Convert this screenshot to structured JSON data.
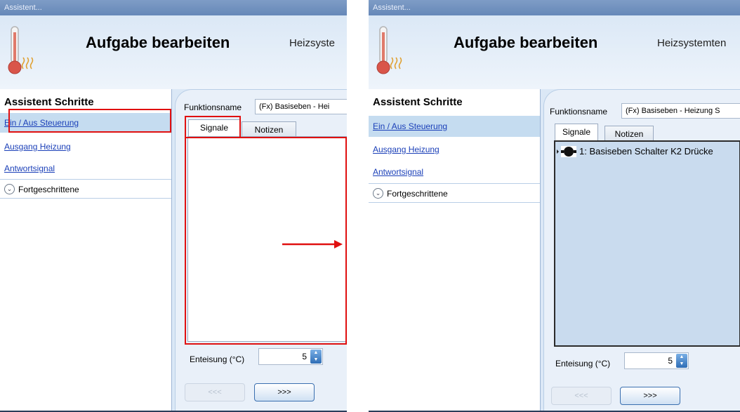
{
  "left": {
    "window_title": "Assistent...",
    "header": {
      "title": "Aufgabe bearbeiten",
      "subtitle": "Heizsyste"
    },
    "steps_title": "Assistent Schritte",
    "steps": [
      "Ein / Aus Steuerung",
      "Ausgang Heizung",
      "Antwortsignal"
    ],
    "advanced_label": "Fortgeschrittene",
    "function_label": "Funktionsname",
    "function_value": "(Fx) Basiseben - Hei",
    "tabs": [
      "Signale",
      "Notizen"
    ],
    "hysteresis_label": "Enteisung (°C)",
    "hysteresis_value": "5",
    "back_label": "<<<",
    "next_label": ">>>"
  },
  "right": {
    "window_title": "Assistent...",
    "header": {
      "title": "Aufgabe bearbeiten",
      "subtitle": "Heizsystemten"
    },
    "steps_title": "Assistent Schritte",
    "steps": [
      "Ein / Aus Steuerung",
      "Ausgang Heizung",
      "Antwortsignal"
    ],
    "advanced_label": "Fortgeschrittene",
    "function_label": "Funktionsname",
    "function_value": "(Fx) Basiseben - Heizung S",
    "tabs": [
      "Signale",
      "Notizen"
    ],
    "signal_item": "1: Basiseben Schalter K2 Drücke",
    "hysteresis_label": "Enteisung (°C)",
    "hysteresis_value": "5",
    "back_label": "<<<",
    "next_label": ">>>"
  },
  "colors": {
    "highlight": "#e01010",
    "selected_step": "#c5dcf0",
    "link": "#1a3fb8"
  },
  "icons": [
    "thermometer-icon",
    "heat-waves-icon",
    "chevron-down-icon",
    "signal-node-icon",
    "spin-up-icon",
    "spin-down-icon",
    "arrow-right-icon"
  ]
}
